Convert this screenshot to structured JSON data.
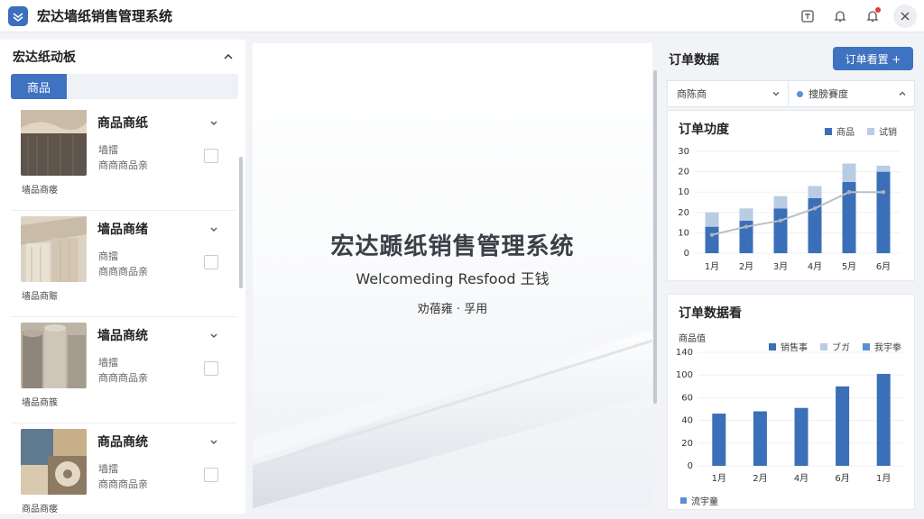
{
  "app": {
    "title": "宏达墙纸销售管理系统"
  },
  "colors": {
    "accent": "#3f72c0",
    "bar_primary": "#3b6fb8",
    "bar_secondary": "#b8cce4",
    "line": "#b9bfc7"
  },
  "titlebar_icons": [
    "translate-icon",
    "bell-icon",
    "alert-bell-icon",
    "close-icon"
  ],
  "left_panel": {
    "title": "宏达纸动板",
    "tab_label": "商品",
    "products": [
      {
        "name": "商品商纸",
        "line1": "墙擂",
        "line2": "商商商品亲",
        "caption": "墙品商瘘"
      },
      {
        "name": "墙品商绪",
        "line1": "商擂",
        "line2": "商商商品亲",
        "caption": "墙品商赈"
      },
      {
        "name": "墙品商统",
        "line1": "墙擂",
        "line2": "商商商品亲",
        "caption": "墙品商簇"
      },
      {
        "name": "商品商统",
        "line1": "墙擂",
        "line2": "商商商品亲",
        "caption": "商品商瘘"
      }
    ]
  },
  "splash": {
    "title": "宏达踬纸销售管理系统",
    "subtitle": "Welcomeding Resfood 王钱",
    "note": "劝蓓雍 · 孚用"
  },
  "right_panel": {
    "title": "订单数据",
    "button_label": "订单看置 +",
    "filter_a": "商陈商",
    "filter_b": "捜膀賽度"
  },
  "chart_data": [
    {
      "type": "bar",
      "title": "订单功度",
      "categories": [
        "1月",
        "2月",
        "3月",
        "4月",
        "5月",
        "6月"
      ],
      "series": [
        {
          "name": "商品",
          "values": [
            13,
            16,
            22,
            27,
            35,
            40
          ]
        },
        {
          "name": "试销",
          "values": [
            7,
            6,
            6,
            6,
            9,
            3
          ]
        }
      ],
      "line": [
        9,
        13,
        16,
        22,
        30,
        30
      ],
      "yticks": [
        "0",
        "10",
        "20",
        "10",
        "20",
        "30"
      ],
      "ylim": [
        0,
        50
      ],
      "legend": "top-right",
      "grid": true
    },
    {
      "type": "bar",
      "title": "订单数据看",
      "ylabel": "商品值",
      "categories": [
        "1月",
        "2月",
        "4月",
        "6月",
        "1月"
      ],
      "series": [
        {
          "name": "销售事",
          "values": [
            46,
            48,
            51,
            70,
            81
          ]
        }
      ],
      "legend_entries": [
        "销售事",
        "ブガ",
        "我宇拳"
      ],
      "bottom_legend": "流宇童",
      "yticks": [
        "0",
        "20",
        "40",
        "60",
        "100",
        "140"
      ],
      "ylim": [
        0,
        100
      ],
      "legend": "top-right",
      "grid": true
    }
  ]
}
